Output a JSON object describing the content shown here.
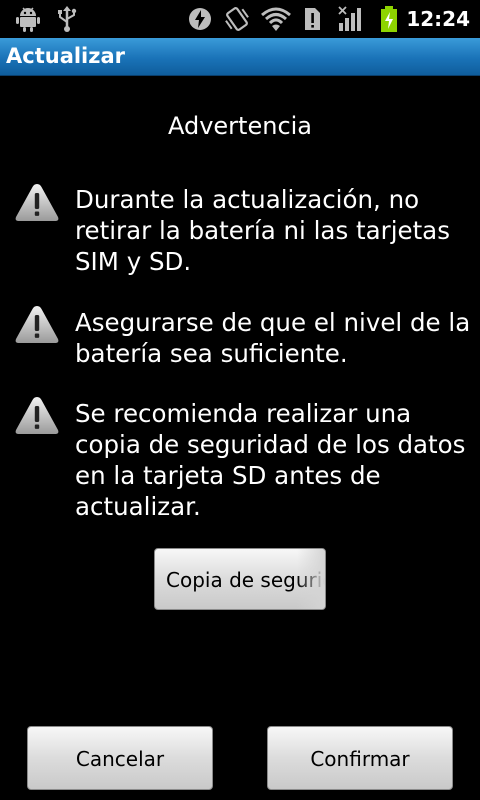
{
  "status_bar": {
    "time": "12:24",
    "icons": [
      "android-debug-icon",
      "usb-icon",
      "data-sync-icon",
      "vibrate-icon",
      "wifi-icon",
      "sim-alert-icon",
      "signal-icon",
      "battery-charging-icon"
    ]
  },
  "app": {
    "title": "Actualizar"
  },
  "content": {
    "heading": "Advertencia",
    "warnings": [
      {
        "icon": "warning-icon",
        "text": "Durante la actualización, no retirar la batería ni las tarjetas SIM y SD."
      },
      {
        "icon": "warning-icon",
        "text": "Asegurarse de que el nivel de la batería sea suficiente."
      },
      {
        "icon": "warning-icon",
        "text": "Se recomienda realizar una copia de seguridad de los datos en la tarjeta SD antes de actualizar."
      }
    ],
    "backup_button": "Copia de seguridad"
  },
  "actions": {
    "cancel": "Cancelar",
    "confirm": "Confirmar"
  },
  "colors": {
    "title_bar": "#1a73b8",
    "background": "#000000",
    "battery": "#8ed400"
  }
}
